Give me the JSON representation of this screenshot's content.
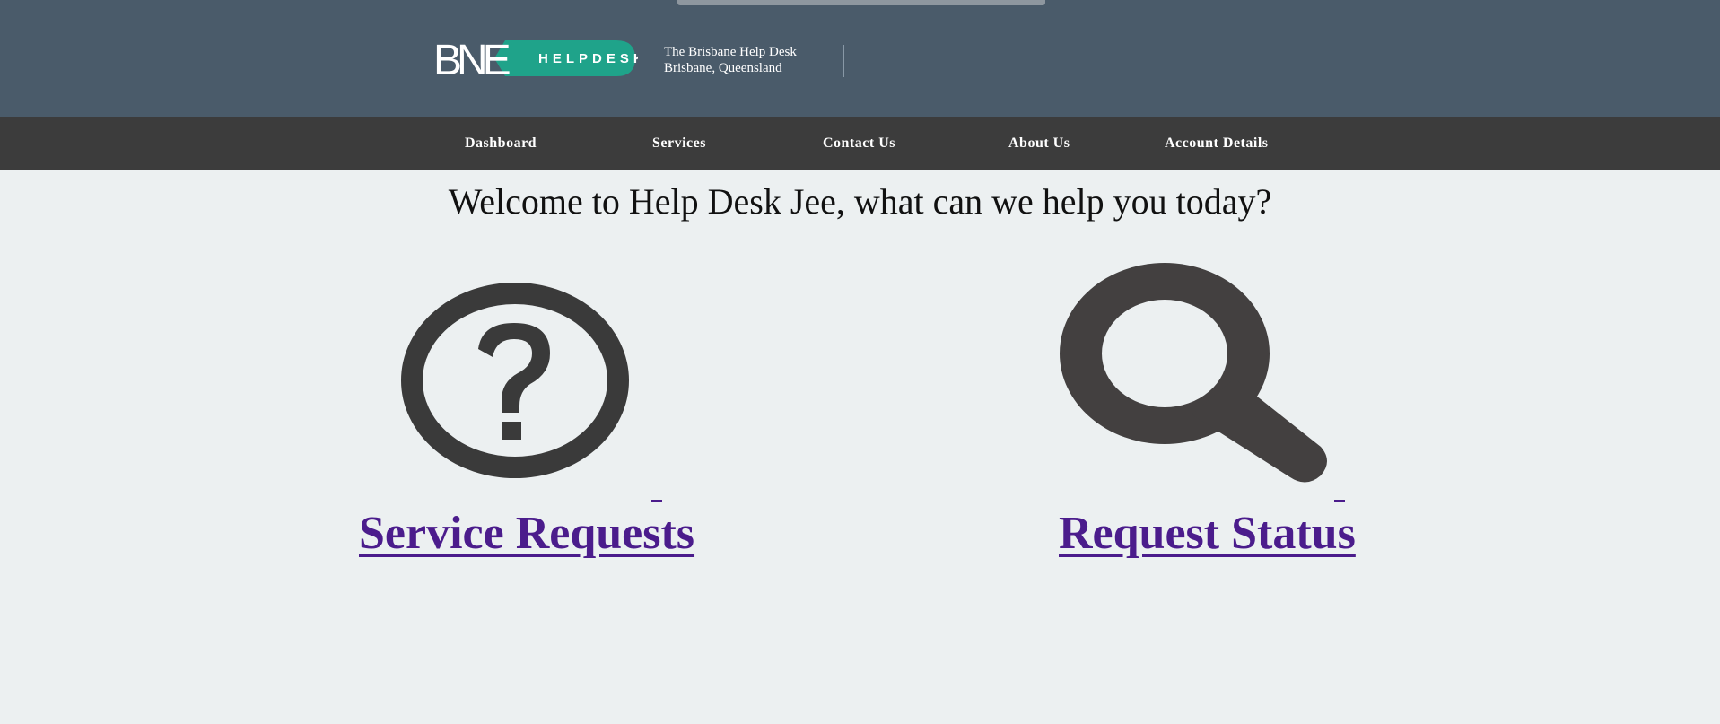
{
  "header": {
    "logo": {
      "wordmark": "BNE",
      "badge_text": "HELPDESK",
      "badge_color": "#1fa38a"
    },
    "site_name": "The Brisbane Help Desk",
    "site_location": "Brisbane, Queensland"
  },
  "nav": {
    "items": [
      {
        "label": "Dashboard"
      },
      {
        "label": "Services"
      },
      {
        "label": "Contact Us"
      },
      {
        "label": "About Us"
      },
      {
        "label": "Account Details"
      }
    ]
  },
  "main": {
    "welcome": "Welcome to Help Desk Jee, what can we help you today?",
    "cards": [
      {
        "label": "Service Requests",
        "icon": "question-circle-icon"
      },
      {
        "label": "Request Status",
        "icon": "magnifier-icon"
      }
    ]
  },
  "colors": {
    "header_bg": "#4a5b6a",
    "nav_bg": "#3c3c3c",
    "page_bg": "#ecf0f1",
    "link": "#4b1c8c",
    "icon": "#3a3a3a"
  }
}
